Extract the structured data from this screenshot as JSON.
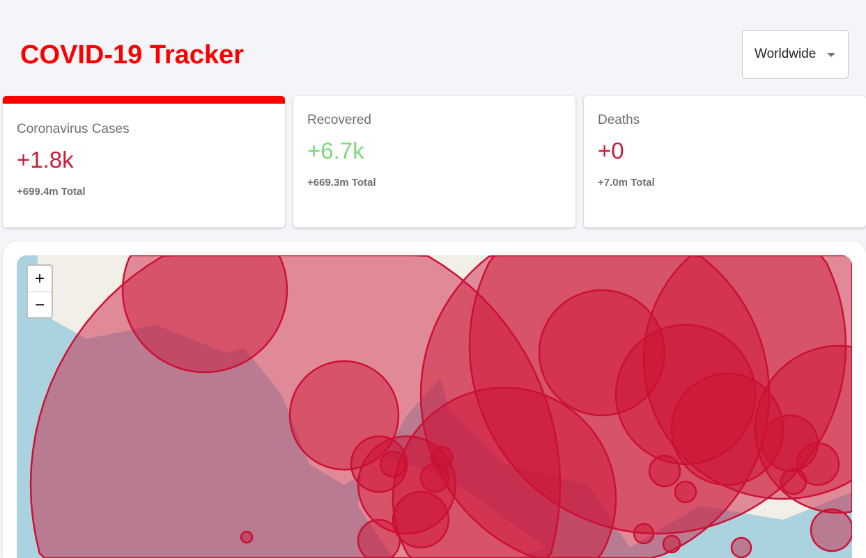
{
  "header": {
    "title": "COVID-19 Tracker",
    "country_select": "Worldwide"
  },
  "cards": [
    {
      "label": "Coronavirus Cases",
      "today": "+1.8k",
      "total": "+699.4m Total",
      "color": "#c41e3a",
      "active": true
    },
    {
      "label": "Recovered",
      "today": "+6.7k",
      "total": "+669.3m Total",
      "color": "#7dd87d",
      "active": false
    },
    {
      "label": "Deaths",
      "today": "+0",
      "total": "+7.0m Total",
      "color": "#c41e3a",
      "active": false
    }
  ],
  "map": {
    "zoom_in": "+",
    "zoom_out": "−",
    "circle_color": "#cc1034"
  }
}
